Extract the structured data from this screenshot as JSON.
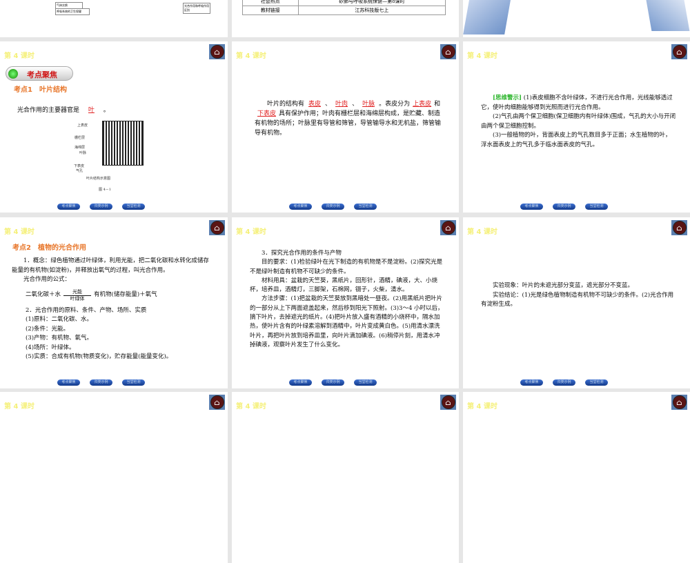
{
  "lesson_label": "第 4 课时",
  "nav_buttons": [
    "考点聚焦",
    "归类示例",
    "当堂检测"
  ],
  "top_row": {
    "diagram_boxes": [
      "气体交换",
      "呼吸系统的卫生保健",
      "光合作用和呼吸作用区别"
    ],
    "table": [
      [
        "社会热点",
        "矽肺与呼吸系统保健—第8课时"
      ],
      [
        "教材链接",
        "江苏科技版七上"
      ]
    ]
  },
  "slide1": {
    "badge": "考点聚焦",
    "heading": "考点1　叶片结构",
    "question": "光合作用的主要器官是",
    "answer": "叶",
    "figure_labels": [
      "上表皮",
      "栅栏层",
      "海绵层",
      "叶脉",
      "下表皮",
      "气孔"
    ],
    "figure_caption": "叶片结构示意图",
    "figure_number": "图 4－1"
  },
  "slide2": {
    "t1": "叶片的结构有",
    "a1": "表皮",
    "a2": "叶肉",
    "a3": "叶脉",
    "t2": "。表皮分为",
    "a4": "上表皮",
    "t3": "和",
    "a5": "下表皮",
    "t4": "具有保护作用；叶肉有栅栏层和海绵层构成，是贮藏、制造有机物的场所；叶脉里有导管和筛管，导管输导水和无机盐，筛管输导有机物。"
  },
  "slide3": {
    "tag": "[思维警示]",
    "p1": "(1)表皮细胞不含叶绿体，不进行光合作用，光线能够透过它，使叶肉细胞能够得到光照而进行光合作用。",
    "p2": "(2)气孔由两个保卫细胞(保卫细胞内有叶绿体)围成，气孔的大小与开闭由两个保卫细胞控制。",
    "p3": "(3)一般植物的叶，背面表皮上的气孔数目多于正面；水生植物的叶，浮水面表皮上的气孔多于临水面表皮的气孔。"
  },
  "slide4": {
    "heading": "考点2　植物的光合作用",
    "p1": "1．概念：绿色植物通过叶绿体，利用光能，把二氧化碳和水转化成储存能量的有机物(如淀粉)，并释放出氧气的过程，叫光合作用。",
    "p2": "光合作用的公式：",
    "eq_left": "二氧化碳＋水",
    "eq_top": "光能",
    "eq_bottom": "叶绿体",
    "eq_right": "有机物(储存能量)＋氧气",
    "p3": "2．光合作用的原料、条件、产物、场所、实质",
    "items": [
      "(1)原料：二氧化碳、水。",
      "(2)条件：光能。",
      "(3)产物：有机物、氧气。",
      "(4)场所：叶绿体。",
      "(5)实质：合成有机物(物质变化)，贮存能量(能量变化)。"
    ]
  },
  "slide5": {
    "h": "3．探究光合作用的条件与产物",
    "p1": "目的要求：(1)检验绿叶在光下制造的有机物是不是淀粉。(2)探究光是不是绿叶制造有机物不可缺少的条件。",
    "p2": "材料用具：盆栽的天竺葵，黑纸片，回形针，酒精，碘液，大、小烧杯，培养皿，酒精灯，三脚架，石棉网，镊子，火柴，清水。",
    "p3": "方法步骤：(1)把盆栽的天竺葵放到黑暗处一昼夜。(2)用黑纸片把叶片的一部分从上下两面遮盖起来，然后移到阳光下照射。(3)3～4 小时以后，摘下叶片，去掉遮光的纸片。(4)把叶片放入盛有酒精的小烧杯中，隔水加热，使叶片含有的叶绿素溶解到酒精中，叶片变成黄白色。(5)用清水漂洗叶片，再把叶片放到培养皿里，向叶片滴加碘液。(6)稍停片刻，用清水冲掉碘液，观察叶片发生了什么变化。"
  },
  "slide6": {
    "p1": "实验现象：叶片的未遮光部分变蓝，遮光部分不变蓝。",
    "p2": "实验结论：(1)光是绿色植物制造有机物不可缺少的条件。(2)光合作用有淀粉生成。"
  }
}
